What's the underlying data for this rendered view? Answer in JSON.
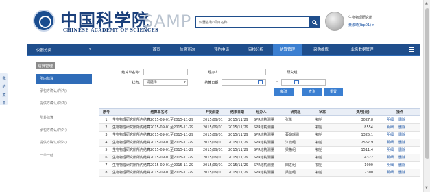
{
  "header": {
    "logo_cn": "中国科学院",
    "logo_en": "CHINESE ACADEMY OF SCIENCES",
    "logo_samp": "SAMP",
    "search_placeholder": "仪器名称/项目名称",
    "user_org": "生物物理研究所",
    "user_name": "黄淑琦(Ibp01) ▾"
  },
  "nav": {
    "select_label": "仪器分类",
    "select_caret": "▾",
    "items": [
      {
        "label": "首页"
      },
      {
        "label": "信息查询"
      },
      {
        "label": "预约申请"
      },
      {
        "label": "审核分析"
      },
      {
        "label": "结算管理"
      },
      {
        "label": "采购维修"
      },
      {
        "label": "业务数据管理"
      }
    ]
  },
  "sidebar": {
    "tab_chars": [
      "我",
      "的",
      "菜",
      "单"
    ],
    "title": "结算管理",
    "items": [
      {
        "label": "所内结算"
      },
      {
        "label": "承包方确认(所内)"
      },
      {
        "label": "提供方确认(所内)"
      },
      {
        "label": "所外结算"
      },
      {
        "label": "承包方确认(所外)"
      },
      {
        "label": "提供方确认(所外)"
      },
      {
        "label": "一单一结"
      }
    ]
  },
  "filter": {
    "name_label": "结算单名称:",
    "status_label": "状态:",
    "status_value": "-请选择-",
    "operator_label": "经办人:",
    "date_label": "结算日期:",
    "date_sep": "-",
    "group_label": "研究组:",
    "add_btn": "新建",
    "query_btn": "查询",
    "reset_btn": "重置"
  },
  "table": {
    "columns": [
      "序号",
      "结算单名称",
      "开始日期",
      "结束日期",
      "经办人",
      "研究组",
      "状态",
      "费用(元)",
      "操作"
    ],
    "rows": [
      {
        "idx": "1",
        "name": "生物物理研究所所内结算2015-09-01至2015-11-29",
        "start": "2015/09/01",
        "end": "2015/11/29",
        "op": "SPR结构测量",
        "group": "张凯",
        "status": "初始",
        "fee": "3027.8",
        "a1": "明细",
        "a2": "删除"
      },
      {
        "idx": "2",
        "name": "生物物理研究所所内结算2015-09-01至2015-11-29",
        "start": "2015/09/01",
        "end": "2015/11/29",
        "op": "SPR结构测量",
        "group": "",
        "status": "初始",
        "fee": "8554",
        "a1": "明细",
        "a2": "删除"
      },
      {
        "idx": "3",
        "name": "生物物理研究所所内结算2015-09-01至2015-11-29",
        "start": "2015/09/01",
        "end": "2015/11/29",
        "op": "SPR结构测量",
        "group": "蔡璐瑶组",
        "status": "初始",
        "fee": "1325.1",
        "a1": "明细",
        "a2": "删除"
      },
      {
        "idx": "4",
        "name": "生物物理研究所所内结算2015-09-01至2015-11-29",
        "start": "2015/09/01",
        "end": "2015/11/29",
        "op": "SPR结构测量",
        "group": "江澳组",
        "status": "初始",
        "fee": "2557.9",
        "a1": "明细",
        "a2": "删除"
      },
      {
        "idx": "5",
        "name": "生物物理研究所所内结算2015-09-01至2015-11-29",
        "start": "2015/09/01",
        "end": "2015/11/29",
        "op": "SPR结构测量",
        "group": "梁格组",
        "status": "初始",
        "fee": "1511.4",
        "a1": "明细",
        "a2": "删除"
      },
      {
        "idx": "6",
        "name": "生物物理研究所所内结算2015-09-01至2015-11-29",
        "start": "2015/09/01",
        "end": "2015/11/29",
        "op": "SPR结构测量",
        "group": "",
        "status": "初始",
        "fee": "4322",
        "a1": "明细",
        "a2": "删除"
      },
      {
        "idx": "7",
        "name": "生物物理研究所所内结算2015-09-01至2015-11-29",
        "start": "2015/09/01",
        "end": "2015/11/29",
        "op": "SPR结构测量",
        "group": "田进组",
        "status": "初始",
        "fee": "1000",
        "a1": "明细",
        "a2": "删除"
      },
      {
        "idx": "8",
        "name": "生物物理研究所所内结算2015-09-01至2015-11-29",
        "start": "2015/09/01",
        "end": "2015/11/29",
        "op": "SPR结构测量",
        "group": "梁佳组",
        "status": "初始",
        "fee": "2300",
        "a1": "明细",
        "a2": "删除"
      }
    ]
  },
  "colors": {
    "nav_bg": "#1f4e8c",
    "nav_active": "#3b7fd1",
    "link": "#1f57a6"
  }
}
